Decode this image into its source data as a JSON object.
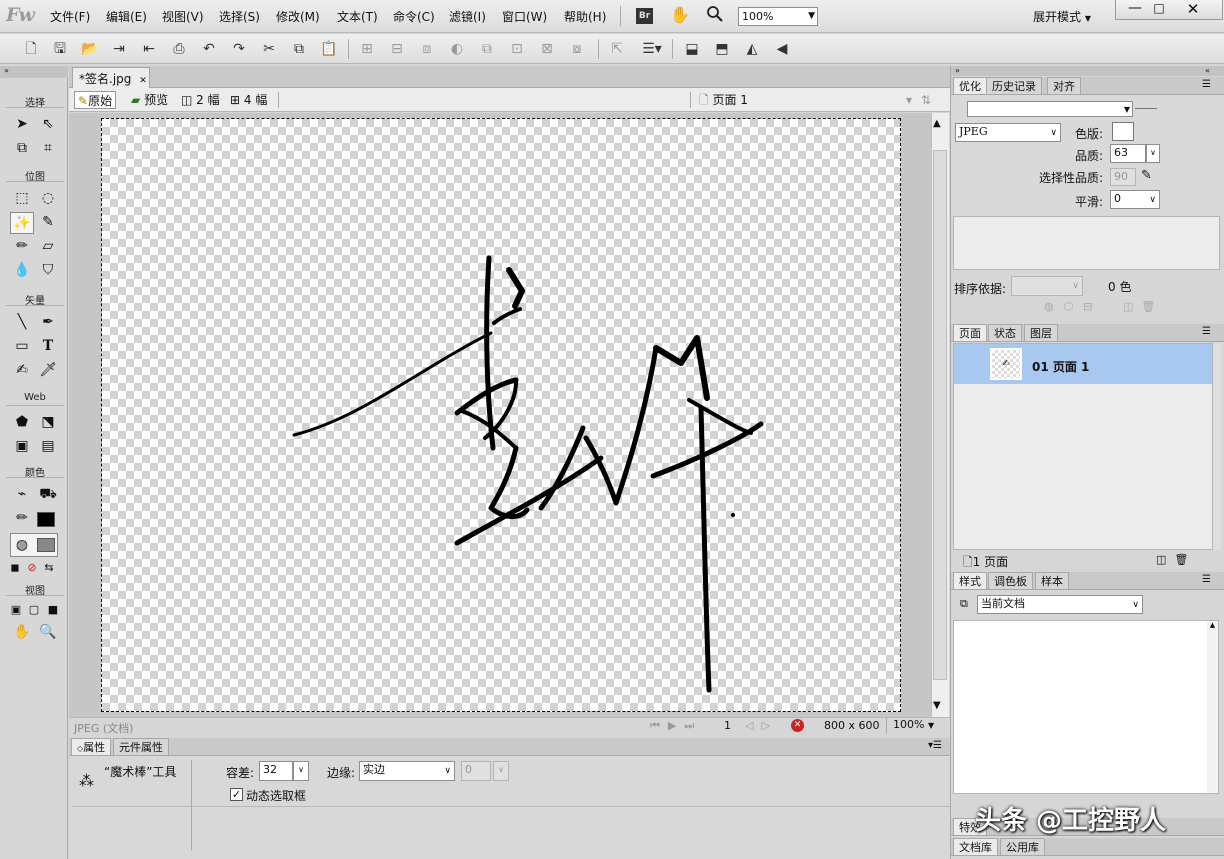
{
  "app": {
    "logo": "Fw"
  },
  "menu": [
    "文件(F)",
    "编辑(E)",
    "视图(V)",
    "选择(S)",
    "修改(M)",
    "文本(T)",
    "命令(C)",
    "滤镜(I)",
    "窗口(W)",
    "帮助(H)"
  ],
  "menubar": {
    "br_label": "Br",
    "zoom": "100%",
    "workspace": "展开模式"
  },
  "tools": {
    "section_select": "选择",
    "section_bitmap": "位图",
    "section_vector": "矢量",
    "section_web": "Web",
    "section_color": "颜色",
    "section_view": "视图",
    "text_tool_glyph": "T"
  },
  "document": {
    "tab_name": "*签名.jpg",
    "views": [
      "原始",
      "预览",
      "2 幅",
      "4 幅"
    ],
    "page_selector": "页面 1",
    "signature": "",
    "status_left": "JPEG (文档)",
    "frame": "1",
    "size": "800 x 600",
    "zoom": "100%"
  },
  "properties": {
    "tabs": [
      "属性",
      "元件属性"
    ],
    "tool_name": "“魔术棒”工具",
    "tolerance_label": "容差:",
    "tolerance_value": "32",
    "edge_label": "边缘:",
    "edge_value": "实边",
    "feather_value": "0",
    "live_marquee_label": "动态选取框",
    "live_marquee_checked": true
  },
  "optimize_panel": {
    "tabs": [
      "优化",
      "历史记录",
      "对齐"
    ],
    "format": "JPEG",
    "matte_label": "色版:",
    "quality_label": "品质:",
    "quality_value": "63",
    "selective_label": "选择性品质:",
    "selective_value": "90",
    "smoothing_label": "平滑:",
    "smoothing_value": "0",
    "sort_label": "排序依据:",
    "colors_count": "0 色"
  },
  "pages_panel": {
    "tabs": [
      "页面",
      "状态",
      "图层"
    ],
    "pages": [
      {
        "label": "01 页面 1"
      }
    ],
    "footer": "1 页面"
  },
  "styles_panel": {
    "tabs": [
      "样式",
      "调色板",
      "样本"
    ],
    "source": "当前文档"
  },
  "bottom_tabs": {
    "row1": "特效",
    "row2": [
      "文档库",
      "公用库"
    ]
  },
  "watermark": "头条 @工控野人",
  "colors": {
    "accent": "#a9c8f0",
    "stroke": "#000000",
    "close_red": "#cc2222"
  }
}
